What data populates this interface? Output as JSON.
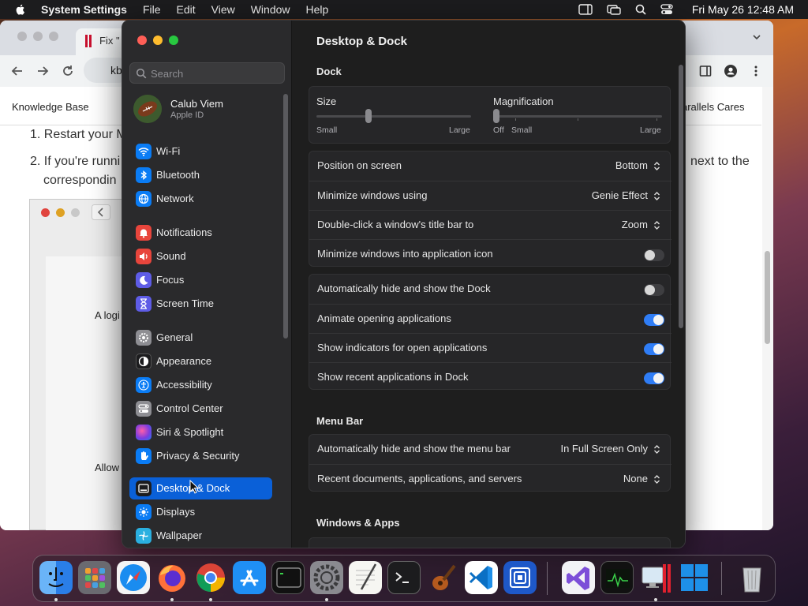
{
  "menubar": {
    "app_name": "System Settings",
    "menus": [
      "File",
      "Edit",
      "View",
      "Window",
      "Help"
    ],
    "clock": "Fri May 26  12:48 AM"
  },
  "browser": {
    "tab_title": "Fix \"",
    "url_fragment": "kb",
    "nav_left": "Knowledge Base",
    "nav_right": "arallels Cares",
    "step1": "1. Restart your M",
    "step2_line1": "2. If you're runni",
    "step2_line2": "correspondin",
    "step2_tail": "next to the",
    "shot_text1": "A logi",
    "shot_text2": "Allow"
  },
  "settings": {
    "search_placeholder": "Search",
    "account": {
      "name": "Calub Viem",
      "sub": "Apple ID"
    },
    "sidebar": [
      {
        "label": "Wi-Fi",
        "icon": "wifi-icon",
        "color": "#0a7cf5"
      },
      {
        "label": "Bluetooth",
        "icon": "bluetooth-icon",
        "color": "#0a7cf5"
      },
      {
        "label": "Network",
        "icon": "globe-icon",
        "color": "#0a7cf5"
      },
      {
        "label": "Notifications",
        "icon": "bell-icon",
        "color": "#e8453c"
      },
      {
        "label": "Sound",
        "icon": "speaker-icon",
        "color": "#e8453c"
      },
      {
        "label": "Focus",
        "icon": "moon-icon",
        "color": "#5e5ce6"
      },
      {
        "label": "Screen Time",
        "icon": "hourglass-icon",
        "color": "#5e5ce6"
      },
      {
        "label": "General",
        "icon": "gear-icon",
        "color": "#8e8e93"
      },
      {
        "label": "Appearance",
        "icon": "appearance-icon",
        "color": "#1c1c1e"
      },
      {
        "label": "Accessibility",
        "icon": "accessibility-icon",
        "color": "#0a7cf5"
      },
      {
        "label": "Control Center",
        "icon": "control-center-icon",
        "color": "#8e8e93"
      },
      {
        "label": "Siri & Spotlight",
        "icon": "siri-icon",
        "color": "#b040d0"
      },
      {
        "label": "Privacy & Security",
        "icon": "hand-icon",
        "color": "#0a7cf5"
      },
      {
        "label": "Desktop & Dock",
        "icon": "dock-icon",
        "color": "#1c1c1e"
      },
      {
        "label": "Displays",
        "icon": "sun-icon",
        "color": "#0a7cf5"
      },
      {
        "label": "Wallpaper",
        "icon": "wallpaper-icon",
        "color": "#2ab0e0"
      }
    ],
    "selected_item": "Desktop & Dock",
    "page_title": "Desktop & Dock",
    "dock_section": "Dock",
    "size": {
      "label": "Size",
      "min": "Small",
      "max": "Large",
      "value": 0.33
    },
    "magnification": {
      "label": "Magnification",
      "off": "Off",
      "min": "Small",
      "max": "Large",
      "value": 0.0
    },
    "dock_rows": [
      {
        "label": "Position on screen",
        "value": "Bottom"
      },
      {
        "label": "Minimize windows using",
        "value": "Genie Effect"
      },
      {
        "label": "Double-click a window's title bar to",
        "value": "Zoom"
      },
      {
        "label": "Minimize windows into application icon",
        "toggle": false
      }
    ],
    "dock_toggles": [
      {
        "label": "Automatically hide and show the Dock",
        "toggle": false
      },
      {
        "label": "Animate opening applications",
        "toggle": true
      },
      {
        "label": "Show indicators for open applications",
        "toggle": true
      },
      {
        "label": "Show recent applications in Dock",
        "toggle": true
      }
    ],
    "menubar_section": "Menu Bar",
    "menubar_rows": [
      {
        "label": "Automatically hide and show the menu bar",
        "value": "In Full Screen Only"
      },
      {
        "label": "Recent documents, applications, and servers",
        "value": "None"
      }
    ],
    "windows_section": "Windows & Apps"
  },
  "dock": {
    "apps": [
      "Finder",
      "Launchpad",
      "Safari",
      "Firefox",
      "Chrome",
      "App Store",
      "Terminal",
      "System Settings",
      "TextEdit",
      "Terminal",
      "GarageBand",
      "Visual Studio Code",
      "Simulator",
      "Visual Studio",
      "Activity Monitor",
      "Parallels Desktop",
      "Windows 11",
      "Trash"
    ]
  }
}
